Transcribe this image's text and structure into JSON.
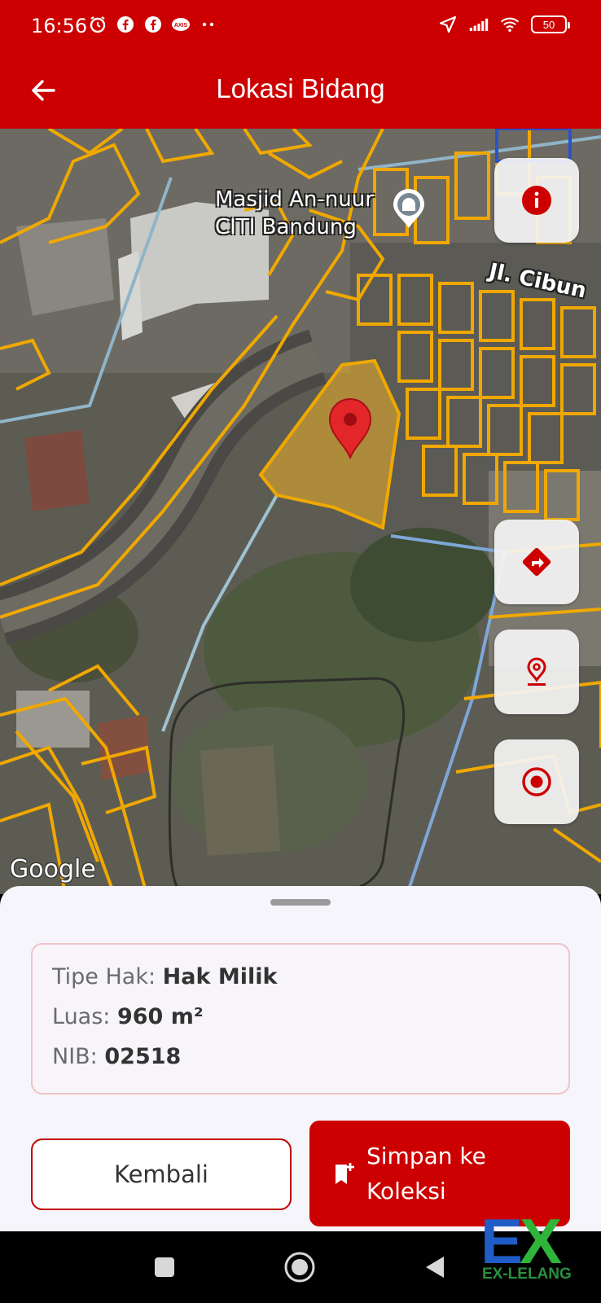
{
  "status_bar": {
    "time": "16:56",
    "battery": "50",
    "left_icons": [
      "alarm-icon",
      "facebook-icon",
      "facebook-icon",
      "axis-icon",
      "more-dots-icon"
    ],
    "right_icons": [
      "location-arrow-icon",
      "signal-icon",
      "wifi-icon",
      "battery-icon"
    ]
  },
  "app_bar": {
    "title": "Lokasi Bidang"
  },
  "map": {
    "poi_label_line1": "Masjid An-nuur",
    "poi_label_line2": "CITI Bandung",
    "road_label": "Jl. Cibun",
    "attribution": "Google",
    "fabs": [
      "info-icon",
      "directions-icon",
      "place-pin-icon",
      "my-location-icon"
    ]
  },
  "parcel_info": {
    "tipe_hak_label": "Tipe Hak:",
    "tipe_hak_value": "Hak Milik",
    "luas_label": "Luas:",
    "luas_value": "960 m²",
    "nib_label": "NIB:",
    "nib_value": "02518"
  },
  "actions": {
    "back_label": "Kembali",
    "save_label_line1": "Simpan ke",
    "save_label_line2": "Koleksi"
  },
  "watermark": {
    "logo_text": "EX",
    "sub_text": "EX-LELANG"
  },
  "colors": {
    "primary": "#cc0000",
    "parcel_outline": "#f0a800",
    "sheet_bg": "#f6f5fb"
  }
}
